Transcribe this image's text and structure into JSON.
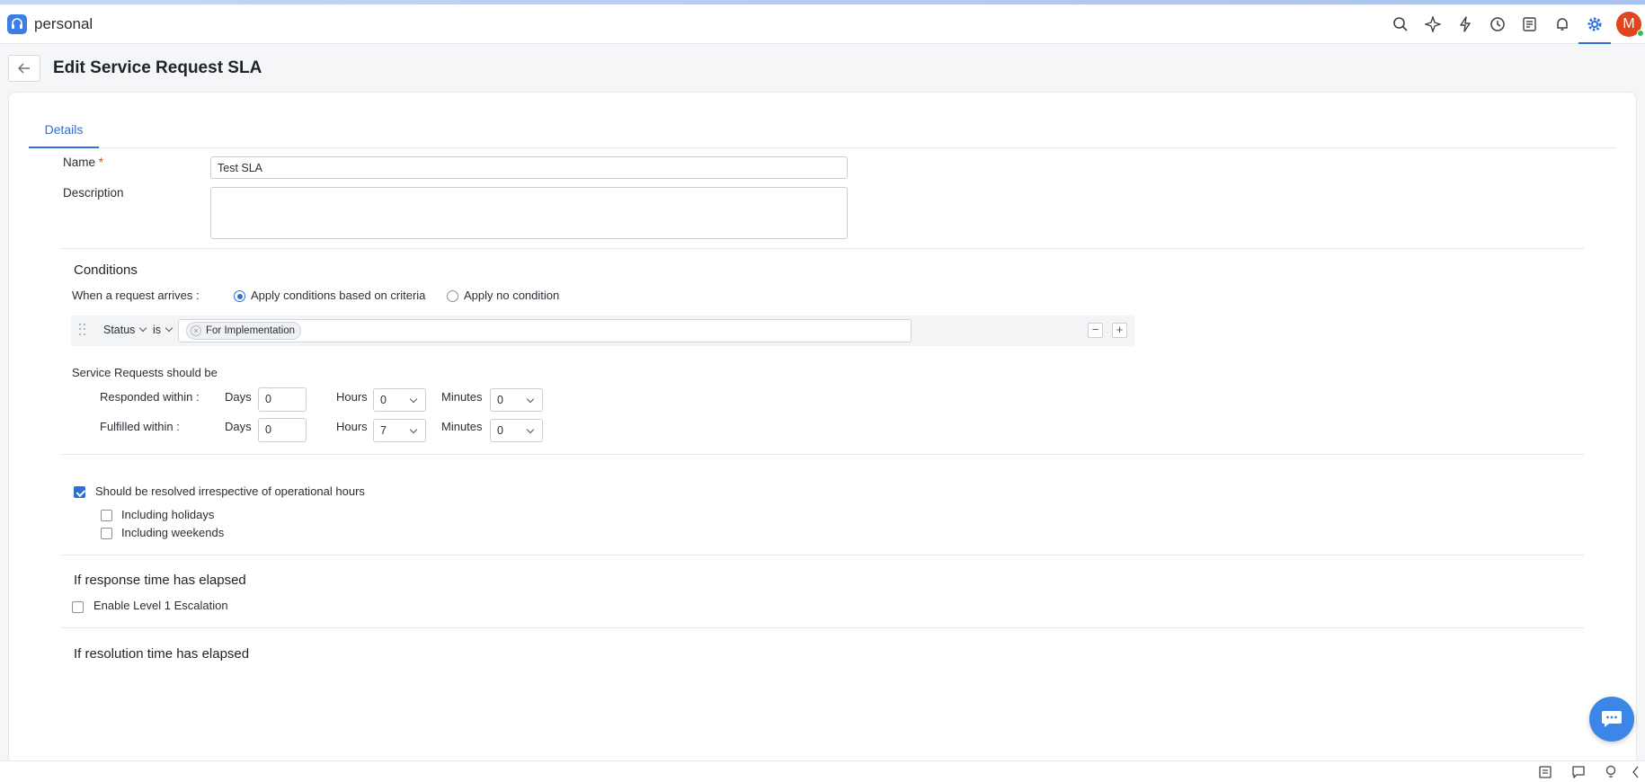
{
  "app": {
    "name": "personal",
    "avatar_initial": "M"
  },
  "header": {
    "icons": [
      "search-icon",
      "sparkle-icon",
      "bolt-icon",
      "history-icon",
      "checklist-icon",
      "bell-icon",
      "gear-icon"
    ]
  },
  "page": {
    "title": "Edit Service Request SLA"
  },
  "tabs": [
    {
      "label": "Details",
      "active": true
    }
  ],
  "form": {
    "name_label": "Name",
    "required_mark": "*",
    "name_value": "Test SLA",
    "description_label": "Description",
    "description_value": ""
  },
  "conditions": {
    "title": "Conditions",
    "arrive_label": "When a request arrives :",
    "option_criteria": "Apply conditions based on criteria",
    "option_none": "Apply no condition",
    "selected_option": "criteria",
    "row": {
      "field": "Status",
      "operator": "is",
      "value_chip": "For Implementation"
    },
    "minus": "−",
    "plus": "+"
  },
  "sla": {
    "heading": "Service Requests should be",
    "responded": {
      "label": "Responded within :",
      "days_label": "Days",
      "days": "0",
      "hours_label": "Hours",
      "hours": "0",
      "minutes_label": "Minutes",
      "minutes": "0"
    },
    "fulfilled": {
      "label": "Fulfilled within :",
      "days_label": "Days",
      "days": "0",
      "hours_label": "Hours",
      "hours": "7",
      "minutes_label": "Minutes",
      "minutes": "0"
    }
  },
  "operational": {
    "resolve_label": "Should be resolved irrespective of operational hours",
    "resolve_checked": true,
    "holidays_label": "Including holidays",
    "holidays_checked": false,
    "weekends_label": "Including weekends",
    "weekends_checked": false
  },
  "response_elapsed": {
    "title": "If response time has elapsed",
    "escalation_label": "Enable Level 1 Escalation",
    "escalation_checked": false
  },
  "resolution_elapsed": {
    "title": "If resolution time has elapsed"
  },
  "colors": {
    "accent": "#2c6fd6",
    "brand": "#3b7ee5",
    "avatar": "#e0451f",
    "chat": "#3b86e6"
  }
}
